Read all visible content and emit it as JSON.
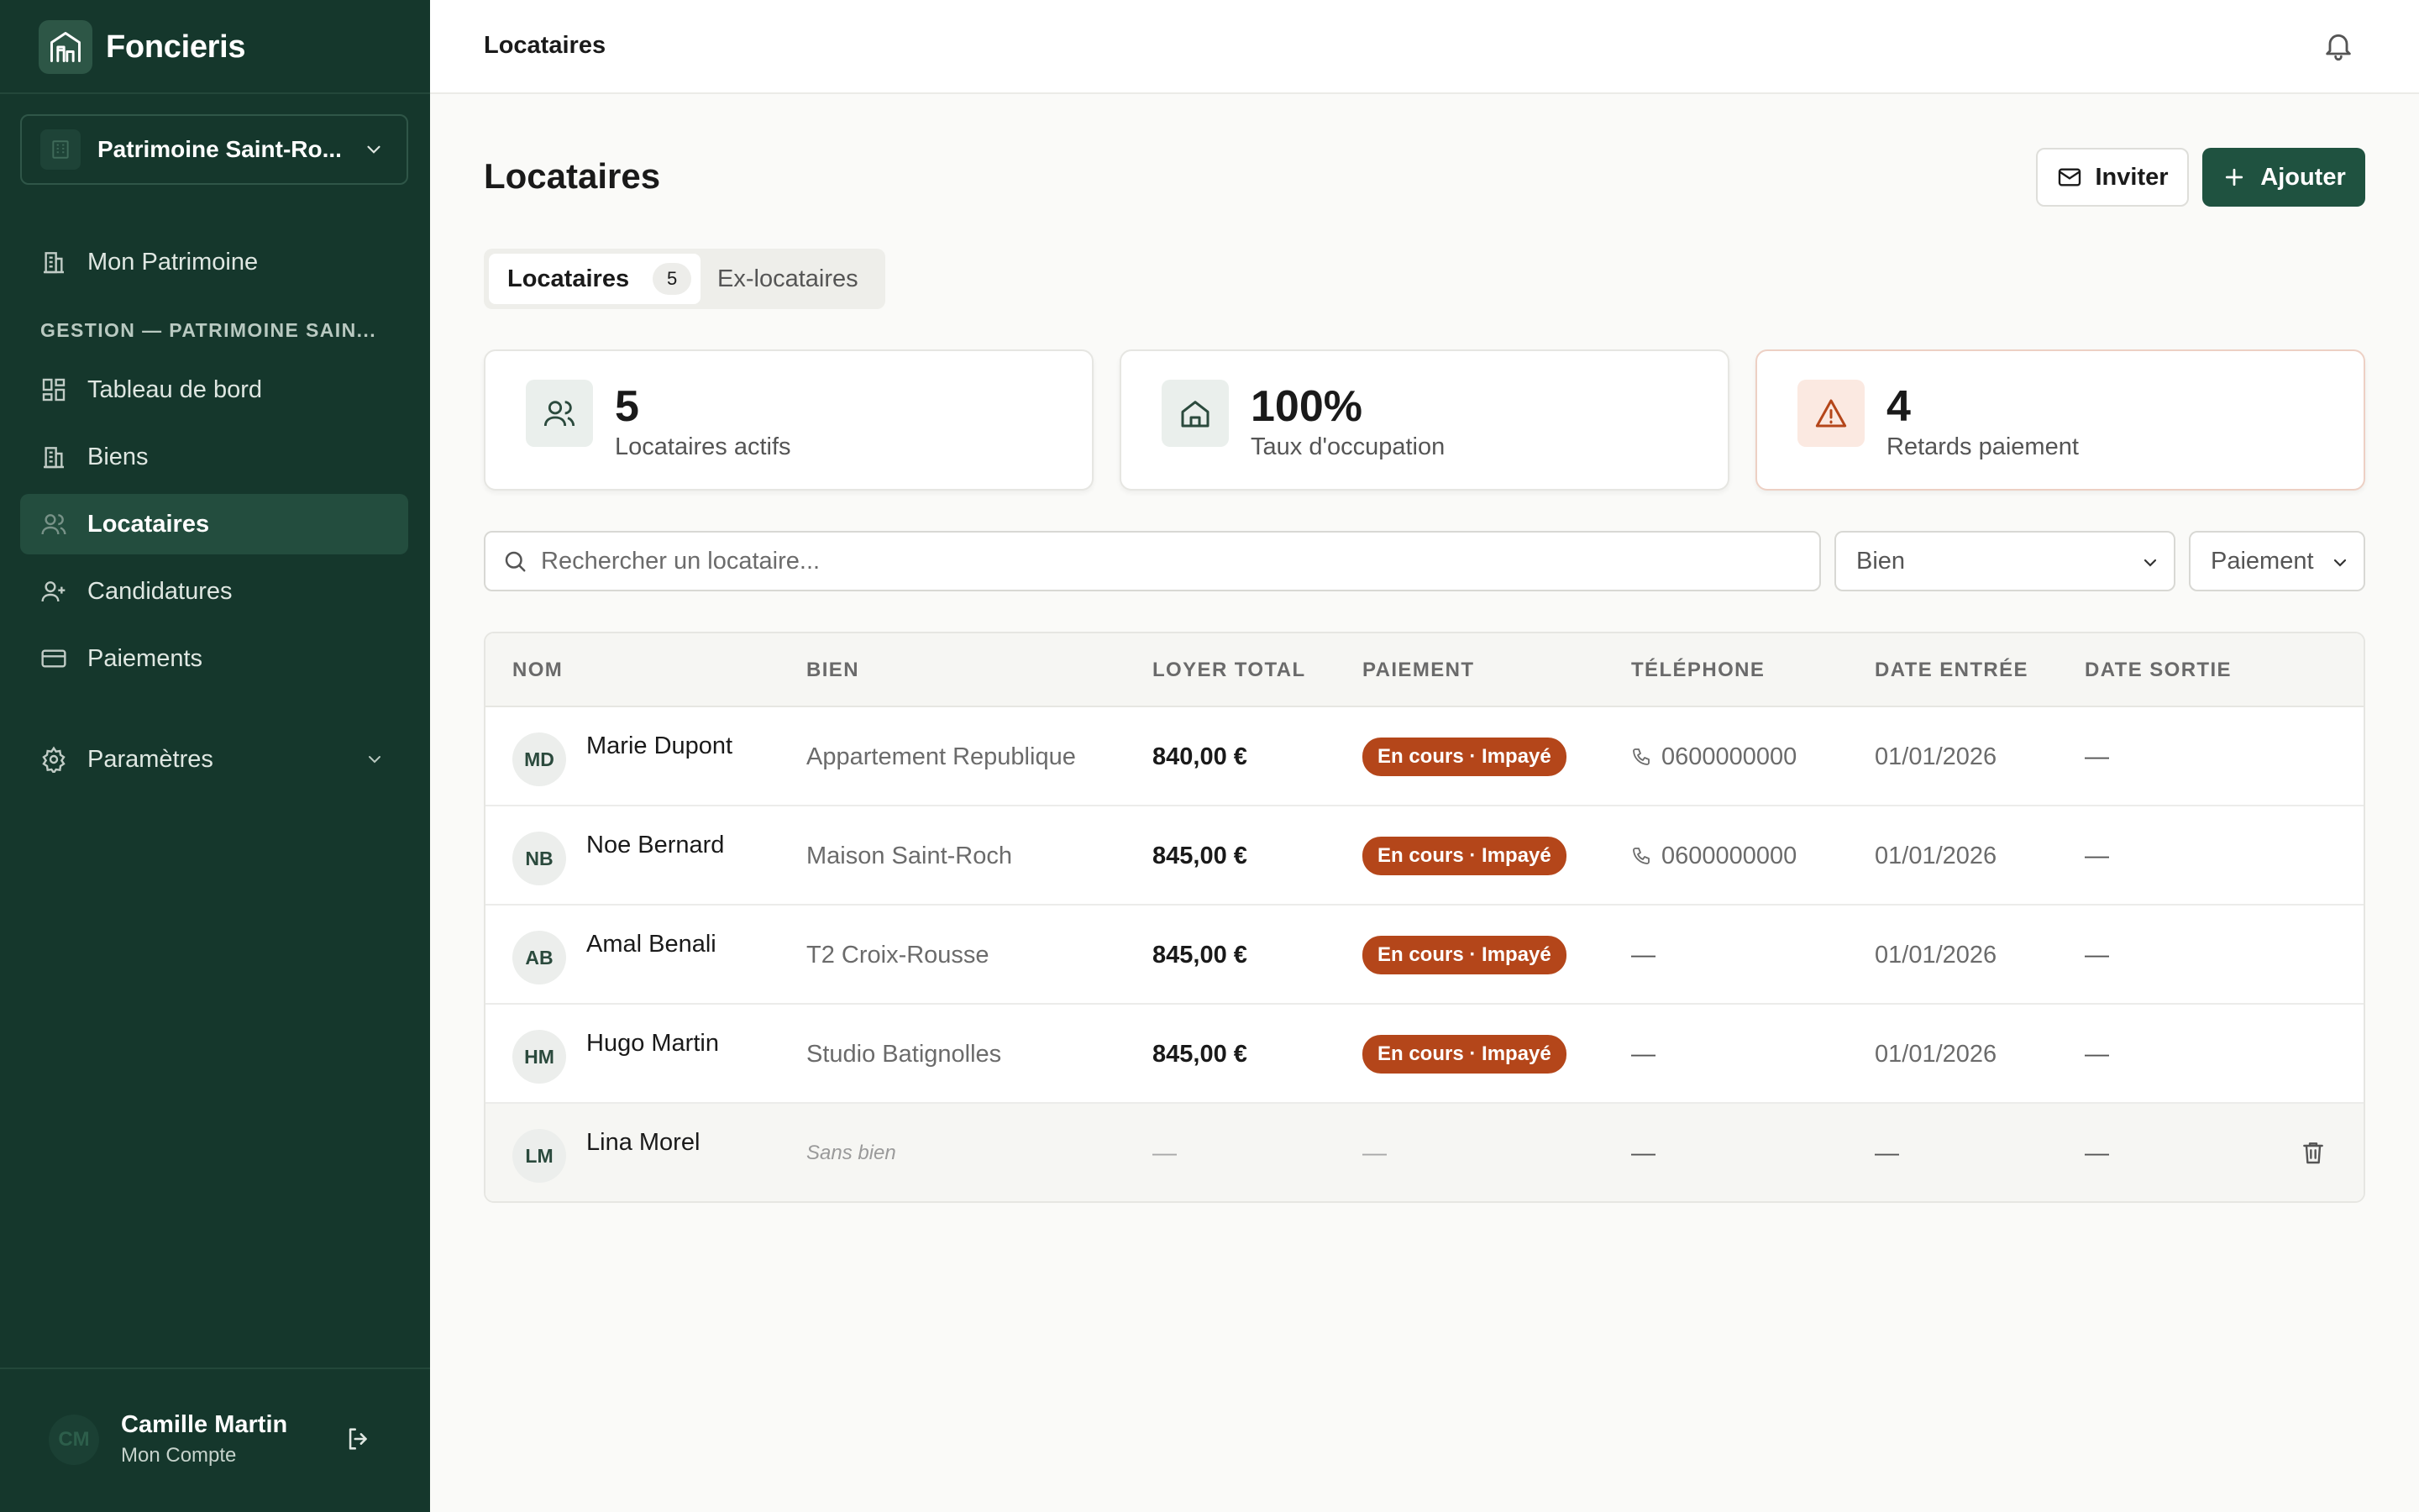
{
  "app": {
    "name": "Foncieris"
  },
  "org": {
    "label": "Patrimoine Saint-Ro..."
  },
  "nav": {
    "top_item": "Mon Patrimoine",
    "section": "GESTION — PATRIMOINE SAIN...",
    "items": [
      "Tableau de bord",
      "Biens",
      "Locataires",
      "Candidatures",
      "Paiements"
    ],
    "settings": "Paramètres",
    "active": "Locataires"
  },
  "user": {
    "initials": "CM",
    "name": "Camille Martin",
    "sub": "Mon Compte"
  },
  "topbar": {
    "title": "Locataires"
  },
  "page": {
    "title": "Locataires"
  },
  "actions": {
    "invite": "Inviter",
    "add": "Ajouter"
  },
  "tabs": [
    {
      "label": "Locataires",
      "count": "5"
    },
    {
      "label": "Ex-locataires"
    }
  ],
  "stats": [
    {
      "value": "5",
      "label": "Locataires actifs",
      "icon": "users-icon"
    },
    {
      "value": "100%",
      "label": "Taux d'occupation",
      "icon": "home-icon"
    },
    {
      "value": "4",
      "label": "Retards paiement",
      "icon": "warning-icon"
    }
  ],
  "filters": {
    "search_placeholder": "Rechercher un locataire...",
    "bien": "Bien",
    "paiement": "Paiement"
  },
  "table": {
    "columns": [
      "NOM",
      "BIEN",
      "LOYER TOTAL",
      "PAIEMENT",
      "TÉLÉPHONE",
      "DATE ENTRÉE",
      "DATE SORTIE"
    ],
    "rows": [
      {
        "initials": "MD",
        "name": "Marie Dupont",
        "bien": "Appartement Republique",
        "loyer": "840,00 €",
        "paiement": "En cours · Impayé",
        "telephone": "0600000000",
        "entree": "01/01/2026",
        "sortie": "—"
      },
      {
        "initials": "NB",
        "name": "Noe Bernard",
        "bien": "Maison Saint-Roch",
        "loyer": "845,00 €",
        "paiement": "En cours · Impayé",
        "telephone": "0600000000",
        "entree": "01/01/2026",
        "sortie": "—"
      },
      {
        "initials": "AB",
        "name": "Amal Benali",
        "bien": "T2 Croix-Rousse",
        "loyer": "845,00 €",
        "paiement": "En cours · Impayé",
        "telephone": "—",
        "entree": "01/01/2026",
        "sortie": "—"
      },
      {
        "initials": "HM",
        "name": "Hugo Martin",
        "bien": "Studio Batignolles",
        "loyer": "845,00 €",
        "paiement": "En cours · Impayé",
        "telephone": "—",
        "entree": "01/01/2026",
        "sortie": "—"
      },
      {
        "initials": "LM",
        "name": "Lina Morel",
        "bien": "Sans bien",
        "loyer": "—",
        "paiement": "—",
        "telephone": "—",
        "entree": "—",
        "sortie": "—"
      }
    ]
  },
  "colors": {
    "sidebar": "#15372c",
    "primary": "#1f5240",
    "danger_pill": "#b4461a"
  }
}
